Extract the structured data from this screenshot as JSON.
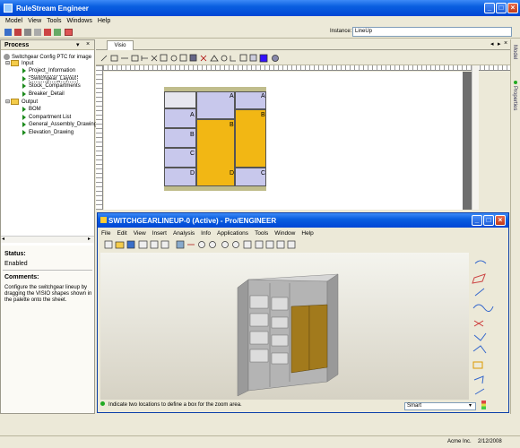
{
  "app": {
    "title": "RuleStream Engineer"
  },
  "menu": [
    "Model",
    "View",
    "Tools",
    "Windows",
    "Help"
  ],
  "instance": {
    "label": "Instance:",
    "value": "LineUp"
  },
  "process": {
    "title": "Process",
    "root": "Switchgear Config PTC for image",
    "input": {
      "label": "Input",
      "items": [
        "Project_Information",
        "Switchgear_Layout",
        "Stock_Compartments",
        "Breaker_Detail"
      ]
    },
    "output": {
      "label": "Output",
      "items": [
        "BOM",
        "Compartment List",
        "General_Assembly_Drawing",
        "Elevation_Drawing"
      ]
    }
  },
  "status": {
    "label": "Status:",
    "value": "Enabled"
  },
  "comments": {
    "label": "Comments:",
    "text": "Configure the switchgear lineup by dragging the VISIO shapes shown in the palette onto the sheet."
  },
  "visio": {
    "tab": "Visio"
  },
  "lineup": {
    "labels": [
      "A",
      "A",
      "A",
      "A",
      "B",
      "B",
      "B",
      "C",
      "C",
      "D",
      "D"
    ]
  },
  "proe": {
    "title": "SWITCHGEARLINEUP-0 (Active) - Pro/ENGINEER",
    "menu": [
      "File",
      "Edit",
      "View",
      "Insert",
      "Analysis",
      "Info",
      "Applications",
      "Tools",
      "Window",
      "Help"
    ],
    "hint": "Indicate two locations to define a box for the zoom area.",
    "filter": "Smart"
  },
  "side_tabs": [
    "Model",
    "Properties"
  ],
  "statusbar": {
    "company": "Acme Inc.",
    "date": "2/12/2008"
  },
  "colors": {
    "xp_blue": "#0a5fe0",
    "orange": "#f2b714",
    "lavender": "#c8c8ec",
    "beige": "#c0bd8c"
  }
}
